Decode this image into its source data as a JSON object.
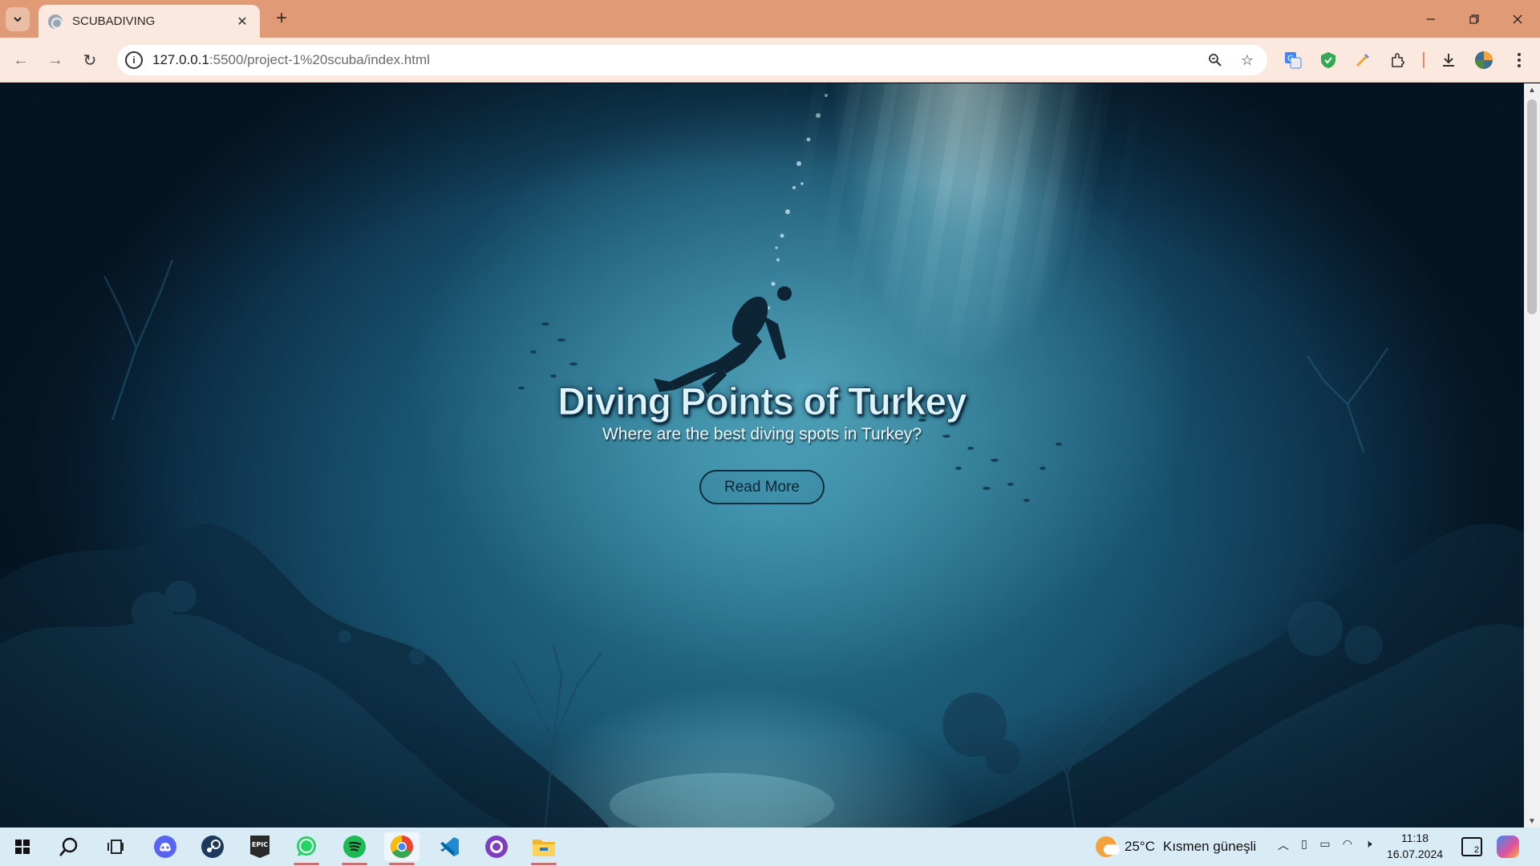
{
  "browser": {
    "tab_title": "SCUBADIVING",
    "url_host": "127.0.0.1",
    "url_path": ":5500/project-1%20scuba/index.html",
    "accent_color": "#e09a76"
  },
  "icons": {
    "tab_list": "chevron-down-icon",
    "favicon": "globe-icon",
    "close": "close-icon",
    "new_tab": "plus-icon",
    "back": "back-arrow-icon",
    "forward": "forward-arrow-icon",
    "reload": "reload-icon",
    "site_info": "info-icon",
    "zoom": "zoom-icon",
    "bookmark": "star-icon",
    "extensions": [
      "translate-icon",
      "shield-icon",
      "pen-icon",
      "puzzle-icon"
    ],
    "download": "download-icon",
    "profile": "avatar-icon",
    "menu": "kebab-menu-icon"
  },
  "page": {
    "title": "Diving Points of Turkey",
    "subtitle": "Where are the best diving spots in Turkey?",
    "read_more_label": "Read More"
  },
  "taskbar": {
    "apps": [
      "windows-start-icon",
      "search-icon",
      "task-view-icon",
      "discord-icon",
      "steam-icon",
      "epic-games-icon",
      "whatsapp-icon",
      "spotify-icon",
      "chrome-icon",
      "vscode-icon",
      "github-desktop-icon",
      "file-explorer-icon"
    ],
    "epic_label": "EPIC",
    "weather_temp": "25°C",
    "weather_text": "Kısmen güneşli",
    "time": "11:18",
    "date": "16.07.2024",
    "notification_count": "2"
  }
}
